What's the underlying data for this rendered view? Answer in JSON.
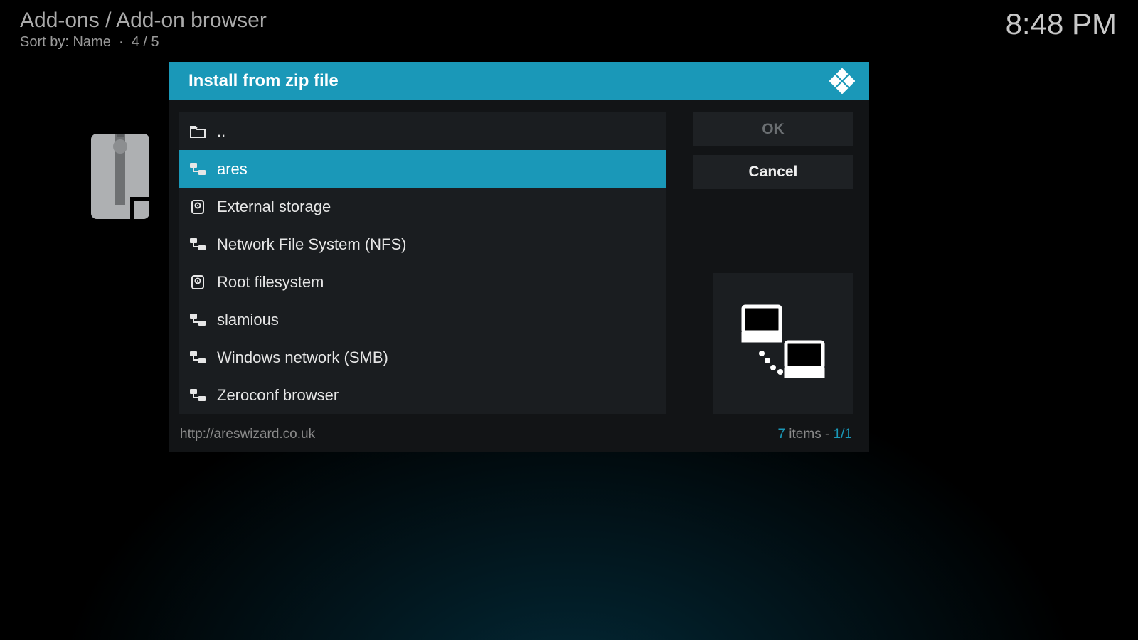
{
  "header": {
    "breadcrumb": "Add-ons / Add-on browser",
    "sort_label": "Sort by: Name",
    "position": "4 / 5",
    "clock": "8:48 PM"
  },
  "dialog": {
    "title": "Install from zip file",
    "ok_label": "OK",
    "cancel_label": "Cancel",
    "path": "http://areswizard.co.uk",
    "items_count_label": " items - ",
    "items_count": "7",
    "page": "1/1"
  },
  "list": {
    "items": [
      {
        "label": "..",
        "icon": "folder-up-icon",
        "selected": false
      },
      {
        "label": "ares",
        "icon": "network-icon",
        "selected": true
      },
      {
        "label": "External storage",
        "icon": "disk-icon",
        "selected": false
      },
      {
        "label": "Network File System (NFS)",
        "icon": "network-icon",
        "selected": false
      },
      {
        "label": "Root filesystem",
        "icon": "disk-icon",
        "selected": false
      },
      {
        "label": "slamious",
        "icon": "network-icon",
        "selected": false
      },
      {
        "label": "Windows network (SMB)",
        "icon": "network-icon",
        "selected": false
      },
      {
        "label": "Zeroconf browser",
        "icon": "network-icon",
        "selected": false
      }
    ]
  }
}
